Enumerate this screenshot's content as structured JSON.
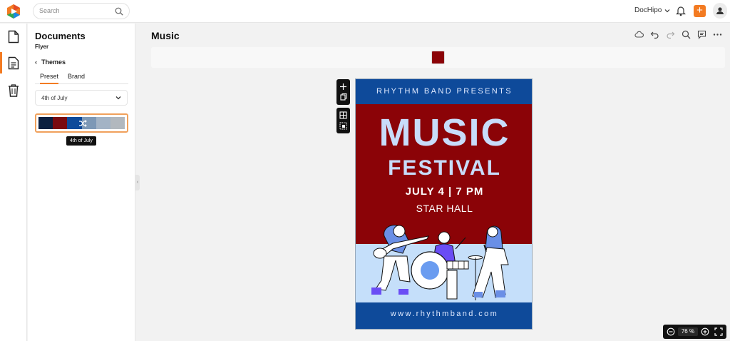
{
  "topbar": {
    "search_placeholder": "Search",
    "account_name": "DocHipo"
  },
  "panel": {
    "title": "Documents",
    "subtitle": "Flyer",
    "back_label": "Themes",
    "tabs": [
      {
        "label": "Preset",
        "active": true
      },
      {
        "label": "Brand",
        "active": false
      }
    ],
    "dropdown_value": "4th of July",
    "palette_colors": [
      "#0c1f3f",
      "#7a0a10",
      "#0e4a9a",
      "#7d98b6",
      "#a3b3c5",
      "#b2b8be"
    ],
    "tooltip": "4th of July"
  },
  "document": {
    "title": "Music",
    "selected_color": "#8b0307"
  },
  "flyer": {
    "top_text": "RHYTHM BAND PRESENTS",
    "headline": "MUSIC",
    "subheadline": "FESTIVAL",
    "date_line": "JULY 4 | 7 PM",
    "venue": "STAR HALL",
    "website": "www.rhythmband.com",
    "colors": {
      "navy": "#0e4a9a",
      "red": "#8b0307",
      "light_blue": "#c5dffa",
      "purple": "#6a4df5"
    }
  },
  "zoom": {
    "value": "76",
    "unit": "%"
  },
  "icons": {
    "logo": "dochipo-logo-icon",
    "search": "search-icon",
    "bell": "bell-icon",
    "plus": "plus-icon",
    "user": "user-icon",
    "rail": [
      "document-new-icon",
      "document-list-icon",
      "trash-icon"
    ],
    "toolbar": [
      "cloud-save-icon",
      "undo-icon",
      "redo-icon",
      "search-icon",
      "comment-icon",
      "more-icon"
    ]
  }
}
